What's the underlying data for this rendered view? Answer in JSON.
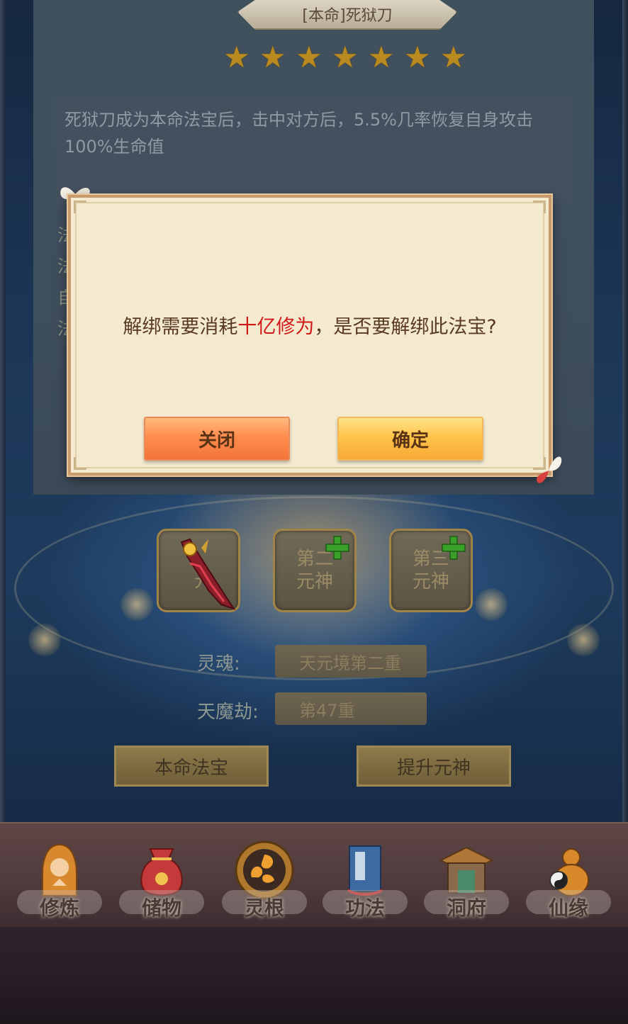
{
  "treasure": {
    "title": "[本命]死狱刀",
    "stars": 7,
    "description": "死狱刀成为本命法宝后，击中对方后，5.5%几率恢复自身攻击100%生命值"
  },
  "side_glyphs": [
    "法",
    "法",
    "自",
    "法"
  ],
  "souls": {
    "slot1_label": [
      "元"
    ],
    "slot2_label": [
      "第二",
      "元神"
    ],
    "slot3_label": [
      "第三",
      "元神"
    ]
  },
  "stats": {
    "soul_label": "灵魂:",
    "soul_value": "天元境第二重",
    "tribulation_label": "天魔劫:",
    "tribulation_value": "第47重"
  },
  "actions": {
    "natal_treasure": "本命法宝",
    "upgrade_soul": "提升元神"
  },
  "nav": [
    {
      "label": "修炼",
      "icon": "cultivate-icon"
    },
    {
      "label": "储物",
      "icon": "storage-bag-icon"
    },
    {
      "label": "灵根",
      "icon": "spirit-root-icon"
    },
    {
      "label": "功法",
      "icon": "skill-book-icon"
    },
    {
      "label": "洞府",
      "icon": "cave-dwelling-icon"
    },
    {
      "label": "仙缘",
      "icon": "immortal-fate-icon"
    }
  ],
  "dialog": {
    "message_before": "解绑需要消耗",
    "message_highlight": "十亿修为",
    "message_after": "，是否要解绑此法宝?",
    "close_label": "关闭",
    "confirm_label": "确定"
  },
  "colors": {
    "highlight": "#d01818",
    "close_button": "#ff8d4e",
    "confirm_button": "#ffc44a"
  }
}
